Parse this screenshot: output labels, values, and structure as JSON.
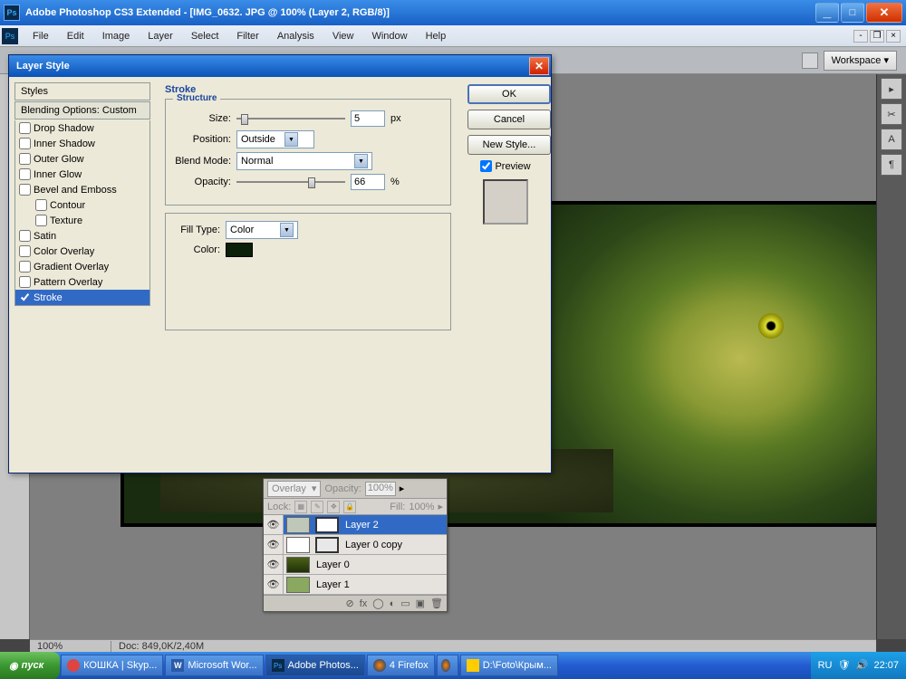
{
  "app": {
    "title": "Adobe Photoshop CS3 Extended - [IMG_0632. JPG @ 100% (Layer 2, RGB/8)]",
    "icon": "Ps"
  },
  "menu": [
    "File",
    "Edit",
    "Image",
    "Layer",
    "Select",
    "Filter",
    "Analysis",
    "View",
    "Window",
    "Help"
  ],
  "workspace": {
    "label": "Workspace ▾"
  },
  "dialog": {
    "title": "Layer Style",
    "styles_header": "Styles",
    "blending_header": "Blending Options: Custom",
    "style_list": [
      {
        "label": "Drop Shadow",
        "checked": false,
        "indent": false
      },
      {
        "label": "Inner Shadow",
        "checked": false,
        "indent": false
      },
      {
        "label": "Outer Glow",
        "checked": false,
        "indent": false
      },
      {
        "label": "Inner Glow",
        "checked": false,
        "indent": false
      },
      {
        "label": "Bevel and Emboss",
        "checked": false,
        "indent": false
      },
      {
        "label": "Contour",
        "checked": false,
        "indent": true
      },
      {
        "label": "Texture",
        "checked": false,
        "indent": true
      },
      {
        "label": "Satin",
        "checked": false,
        "indent": false
      },
      {
        "label": "Color Overlay",
        "checked": false,
        "indent": false
      },
      {
        "label": "Gradient Overlay",
        "checked": false,
        "indent": false
      },
      {
        "label": "Pattern Overlay",
        "checked": false,
        "indent": false
      },
      {
        "label": "Stroke",
        "checked": true,
        "indent": false,
        "active": true
      }
    ],
    "panel_title": "Stroke",
    "structure_title": "Structure",
    "size_label": "Size:",
    "size_value": "5",
    "size_unit": "px",
    "size_pct": 4,
    "position_label": "Position:",
    "position_value": "Outside",
    "blend_label": "Blend Mode:",
    "blend_value": "Normal",
    "opacity_label": "Opacity:",
    "opacity_value": "66",
    "opacity_unit": "%",
    "opacity_pct": 66,
    "filltype_label": "Fill Type:",
    "filltype_value": "Color",
    "color_label": "Color:",
    "color_value": "#0a2008",
    "btn_ok": "OK",
    "btn_cancel": "Cancel",
    "btn_new": "New Style...",
    "preview_label": "Preview"
  },
  "layers_panel": {
    "blend_mode": "Overlay",
    "opacity_label": "Opacity:",
    "opacity_value": "100%",
    "lock_label": "Lock:",
    "fill_label": "Fill:",
    "fill_value": "100%",
    "layers": [
      {
        "name": "Layer 2",
        "active": true,
        "mask": true,
        "thumb": "#bfc7b8"
      },
      {
        "name": "Layer 0 copy",
        "active": false,
        "mask": true,
        "thumb": "#fff",
        "thumb2": "#e8e8e8"
      },
      {
        "name": "Layer 0",
        "active": false,
        "mask": false,
        "thumb": "linear-gradient(#4a6018,#203008)"
      },
      {
        "name": "Layer 1",
        "active": false,
        "mask": false,
        "thumb": "#8aa860"
      }
    ]
  },
  "status": {
    "zoom": "100%",
    "doc": "Doc: 849,0K/2,40M"
  },
  "taskbar": {
    "start": "пуск",
    "items": [
      {
        "label": "КОШКА | Skyp...",
        "icon": "skype"
      },
      {
        "label": "Microsoft Wor...",
        "icon": "word"
      },
      {
        "label": "Adobe Photos...",
        "icon": "ps",
        "active": true
      },
      {
        "label": "4 Firefox",
        "icon": "ff"
      },
      {
        "label": "",
        "icon": "ff",
        "narrow": true
      },
      {
        "label": "D:\\Foto\\Крым...",
        "icon": "tc"
      }
    ],
    "lang": "RU",
    "time": "22:07"
  }
}
